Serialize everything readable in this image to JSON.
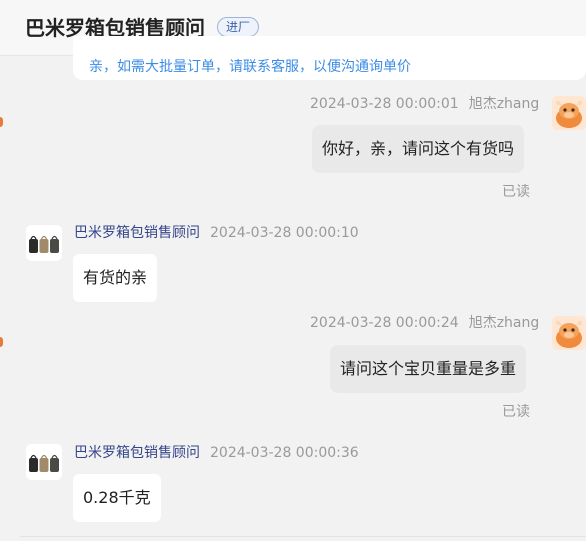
{
  "header": {
    "title": "巴米罗箱包销售顾问",
    "badge": "进厂"
  },
  "prev_message": {
    "text": "亲，如需大批量订单，请联系客服，以便沟通询单价"
  },
  "messages": [
    {
      "side": "right",
      "timestamp": "2024-03-28 00:00:01",
      "sender": "旭杰zhang",
      "text": "你好，亲，请问这个有货吗",
      "status": "已读"
    },
    {
      "side": "left",
      "sender": "巴米罗箱包销售顾问",
      "timestamp": "2024-03-28 00:00:10",
      "text": "有货的亲"
    },
    {
      "side": "right",
      "timestamp": "2024-03-28 00:00:24",
      "sender": "旭杰zhang",
      "text": "请问这个宝贝重量是多重",
      "status": "已读"
    },
    {
      "side": "left",
      "sender": "巴米罗箱包销售顾问",
      "timestamp": "2024-03-28 00:00:36",
      "text": "0.28千克"
    }
  ],
  "colors": {
    "background": "#f2f2f2",
    "right_bubble": "#e9e9e9",
    "left_bubble": "#ffffff",
    "merchant_name": "#34458a",
    "badge_text": "#3a63ad",
    "timestamp": "#9a9a9a"
  },
  "icons": {
    "user_avatar": "cartoon-cow-avatar-icon",
    "merchant_avatar": "backpacks-product-avatar-icon"
  }
}
